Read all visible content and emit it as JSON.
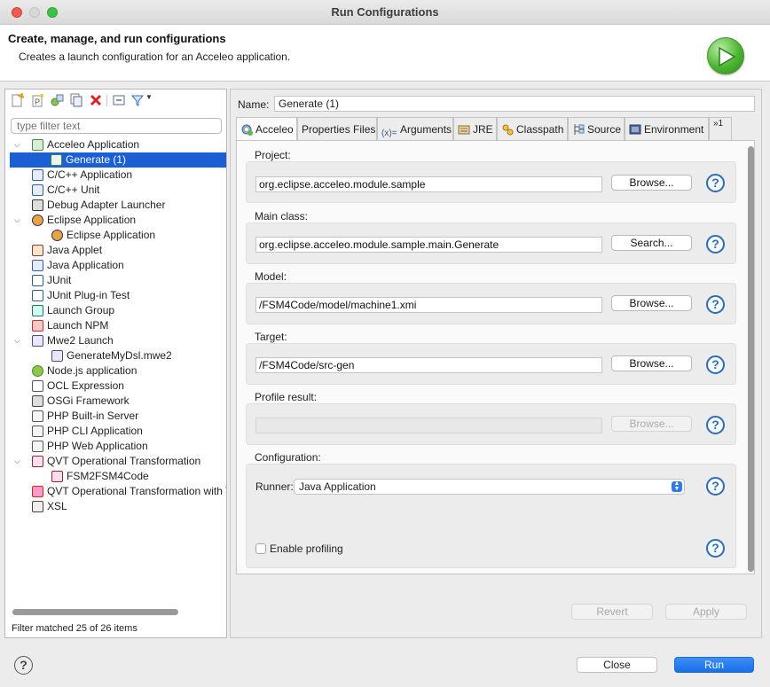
{
  "window": {
    "title": "Run Configurations"
  },
  "header": {
    "title": "Create, manage, and run configurations",
    "description": "Creates a launch configuration for an Acceleo application."
  },
  "left": {
    "filter_placeholder": "type filter text",
    "tree": [
      {
        "label": "Acceleo Application",
        "level": 0,
        "expanded": true,
        "icon": "acceleo-icon"
      },
      {
        "label": "Generate (1)",
        "level": 1,
        "selected": true,
        "icon": "acceleo-config-icon"
      },
      {
        "label": "C/C++ Application",
        "level": 0,
        "icon": "c-app-icon"
      },
      {
        "label": "C/C++ Unit",
        "level": 0,
        "icon": "c-unit-icon"
      },
      {
        "label": "Debug Adapter Launcher",
        "level": 0,
        "icon": "debug-adapter-icon"
      },
      {
        "label": "Eclipse Application",
        "level": 0,
        "expanded": true,
        "icon": "eclipse-icon"
      },
      {
        "label": "Eclipse Application",
        "level": 1,
        "icon": "eclipse-icon"
      },
      {
        "label": "Java Applet",
        "level": 0,
        "icon": "java-applet-icon"
      },
      {
        "label": "Java Application",
        "level": 0,
        "icon": "java-app-icon"
      },
      {
        "label": "JUnit",
        "level": 0,
        "icon": "junit-icon"
      },
      {
        "label": "JUnit Plug-in Test",
        "level": 0,
        "icon": "junit-plugin-icon"
      },
      {
        "label": "Launch Group",
        "level": 0,
        "icon": "launch-group-icon"
      },
      {
        "label": "Launch NPM",
        "level": 0,
        "icon": "npm-icon"
      },
      {
        "label": "Mwe2 Launch",
        "level": 0,
        "expanded": true,
        "icon": "mwe2-icon"
      },
      {
        "label": "GenerateMyDsl.mwe2",
        "level": 1,
        "icon": "mwe2-file-icon"
      },
      {
        "label": "Node.js application",
        "level": 0,
        "icon": "nodejs-icon"
      },
      {
        "label": "OCL Expression",
        "level": 0,
        "icon": "ocl-icon"
      },
      {
        "label": "OSGi Framework",
        "level": 0,
        "icon": "osgi-icon"
      },
      {
        "label": "PHP Built-in Server",
        "level": 0,
        "icon": "php-icon"
      },
      {
        "label": "PHP CLI Application",
        "level": 0,
        "icon": "php-icon"
      },
      {
        "label": "PHP Web Application",
        "level": 0,
        "icon": "php-icon"
      },
      {
        "label": "QVT Operational Transformation",
        "level": 0,
        "expanded": true,
        "icon": "qvt-icon"
      },
      {
        "label": "FSM2FSM4Code",
        "level": 1,
        "icon": "qvt-file-icon"
      },
      {
        "label": "QVT Operational Transformation with Tracing",
        "level": 0,
        "icon": "qvt-trace-icon"
      },
      {
        "label": "XSL",
        "level": 0,
        "icon": "xsl-icon"
      }
    ],
    "status": "Filter matched 25 of 26 items"
  },
  "right": {
    "name_label": "Name:",
    "name_value": "Generate (1)",
    "tabs": [
      {
        "label": "Acceleo",
        "icon": "acceleo-tab-icon",
        "active": true
      },
      {
        "label": "Properties Files",
        "icon": ""
      },
      {
        "label": "Arguments",
        "icon": "arguments-icon"
      },
      {
        "label": "JRE",
        "icon": "jre-icon"
      },
      {
        "label": "Classpath",
        "icon": "classpath-icon"
      },
      {
        "label": "Source",
        "icon": "source-icon"
      },
      {
        "label": "Environment",
        "icon": "environment-icon"
      },
      {
        "label": "»1",
        "icon": ""
      }
    ],
    "project": {
      "label": "Project:",
      "value": "org.eclipse.acceleo.module.sample",
      "button": "Browse..."
    },
    "main_class": {
      "label": "Main class:",
      "value": "org.eclipse.acceleo.module.sample.main.Generate",
      "button": "Search..."
    },
    "model": {
      "label": "Model:",
      "value": "/FSM4Code/model/machine1.xmi",
      "button": "Browse..."
    },
    "target": {
      "label": "Target:",
      "value": "/FSM4Code/src-gen",
      "button": "Browse..."
    },
    "profile_result": {
      "label": "Profile result:",
      "value": "",
      "button": "Browse..."
    },
    "configuration": {
      "label": "Configuration:",
      "runner_label": "Runner:",
      "runner_value": "Java Application",
      "profiling_label": "Enable profiling"
    },
    "help_symbol": "?",
    "revert": "Revert",
    "apply": "Apply"
  },
  "footer": {
    "close": "Close",
    "run": "Run",
    "help_symbol": "?"
  },
  "colors": {
    "selection": "#1a5fd4",
    "primary_button": "#1a6fe8",
    "help_blue": "#2c6db3"
  }
}
